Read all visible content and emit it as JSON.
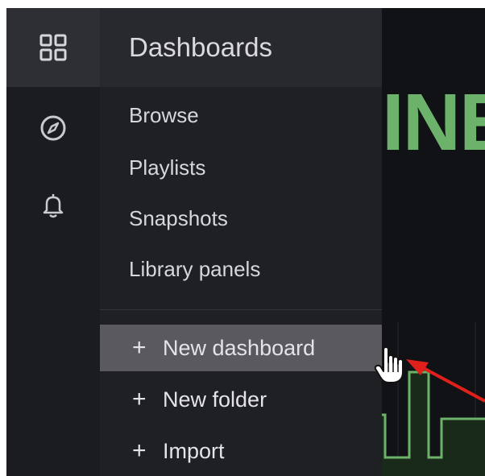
{
  "menu": {
    "title": "Dashboards",
    "items": [
      {
        "label": "Browse"
      },
      {
        "label": "Playlists"
      },
      {
        "label": "Snapshots"
      },
      {
        "label": "Library panels"
      }
    ],
    "actions": [
      {
        "plus": "+",
        "label": "New dashboard",
        "state": "hover"
      },
      {
        "plus": "+",
        "label": "New folder"
      },
      {
        "plus": "+",
        "label": "Import"
      }
    ]
  },
  "rail": {
    "icons": [
      "dashboards-grid-icon",
      "explore-compass-icon",
      "alerting-bell-icon"
    ]
  },
  "background": {
    "title_fragment": "INE"
  },
  "colors": {
    "accent_green": "#6db26b",
    "arrow_red": "#e0201a",
    "menu_bg": "#1f2024",
    "hover_bg": "#5a5a5e"
  }
}
